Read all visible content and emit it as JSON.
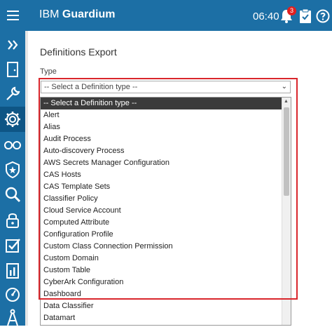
{
  "header": {
    "brand_prefix": "IBM",
    "brand_name": "Guardium",
    "time": "06:40",
    "notification_count": "3",
    "bg_color": "#1c6fa5"
  },
  "sidebar": {
    "items": [
      {
        "icon": "double-chevron-right-icon"
      },
      {
        "icon": "door-icon"
      },
      {
        "icon": "wrench-icon"
      },
      {
        "icon": "gear-icon",
        "active": true
      },
      {
        "icon": "glasses-icon"
      },
      {
        "icon": "shield-star-icon"
      },
      {
        "icon": "search-icon"
      },
      {
        "icon": "lock-icon"
      },
      {
        "icon": "checkbox-icon"
      },
      {
        "icon": "report-icon"
      },
      {
        "icon": "gauge-icon"
      },
      {
        "icon": "compass-icon"
      }
    ]
  },
  "main": {
    "title": "Definitions Export",
    "type_label": "Type",
    "select_value": "-- Select a Definition type --",
    "options": [
      "-- Select a Definition type --",
      "Alert",
      "Alias",
      "Audit Process",
      "Auto-discovery Process",
      "AWS Secrets Manager Configuration",
      "CAS Hosts",
      "CAS Template Sets",
      "Classifier Policy",
      "Cloud Service Account",
      "Computed Attribute",
      "Configuration Profile",
      "Custom Class Connection Permission",
      "Custom Domain",
      "Custom Table",
      "CyberArk Configuration",
      "Dashboard",
      "Data Classifier",
      "Datamart"
    ],
    "highlight_color": "#d9262c"
  }
}
